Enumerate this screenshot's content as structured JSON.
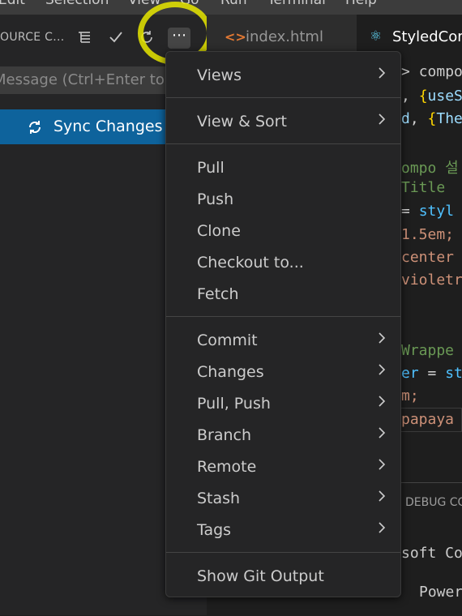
{
  "menubar": {
    "items": [
      "Edit",
      "Selection",
      "View",
      "Go",
      "Run",
      "Terminal",
      "Help"
    ]
  },
  "scm": {
    "title": "OURCE C...",
    "message_placeholder": "Message (Ctrl+Enter to co",
    "sync_label": "Sync Changes",
    "more_glyph": "⋯"
  },
  "tabs": [
    {
      "label": "index.html",
      "icon": "html-file-icon"
    },
    {
      "label": "StyledCom",
      "icon": "react-file-icon"
    }
  ],
  "editor": {
    "lines": [
      {
        "segments": [
          {
            "text": "> ",
            "color": "#cccccc"
          },
          {
            "text": "compo",
            "color": "#cccccc"
          }
        ]
      },
      {
        "segments": [
          {
            "text": ", ",
            "color": "#d4d4d4"
          },
          {
            "text": "{",
            "color": "#ffd700"
          },
          {
            "text": "useS",
            "color": "#9cdcfe"
          }
        ]
      },
      {
        "segments": [
          {
            "text": "d",
            "color": "#9cdcfe"
          },
          {
            "text": ", ",
            "color": "#d4d4d4"
          },
          {
            "text": "{",
            "color": "#ffd700"
          },
          {
            "text": "The",
            "color": "#9cdcfe"
          }
        ]
      },
      {
        "segments": [
          {
            "text": "ompo 설",
            "color": "#6a9955"
          }
        ]
      },
      {
        "segments": [
          {
            "text": " Title",
            "color": "#6a9955"
          }
        ]
      },
      {
        "segments": [
          {
            "text": " = ",
            "color": "#d4d4d4"
          },
          {
            "text": "styl",
            "color": "#4fc1ff"
          }
        ]
      },
      {
        "segments": [
          {
            "text": "1.5em;",
            "color": "#ce9178"
          }
        ]
      },
      {
        "segments": [
          {
            "text": " center",
            "color": "#ce9178"
          }
        ]
      },
      {
        "segments": [
          {
            "text": "violetr",
            "color": "#ce9178"
          }
        ]
      },
      {
        "segments": [
          {
            "text": " Wrappe",
            "color": "#6a9955"
          }
        ]
      },
      {
        "segments": [
          {
            "text": "er",
            "color": "#4fc1ff"
          },
          {
            "text": " = ",
            "color": "#d4d4d4"
          },
          {
            "text": "st",
            "color": "#4fc1ff"
          }
        ]
      },
      {
        "segments": [
          {
            "text": "m;",
            "color": "#ce9178"
          }
        ]
      },
      {
        "segments": [
          {
            "text": " papaya",
            "color": "#ce9178"
          }
        ]
      }
    ]
  },
  "panel": {
    "tab_label": "DEBUG CO",
    "line1": "soft Co",
    "line2": "Power"
  },
  "context_menu": {
    "groups": [
      [
        {
          "label": "Views",
          "submenu": true
        }
      ],
      [
        {
          "label": "View & Sort",
          "submenu": true
        }
      ],
      [
        {
          "label": "Pull",
          "submenu": false
        },
        {
          "label": "Push",
          "submenu": false
        },
        {
          "label": "Clone",
          "submenu": false
        },
        {
          "label": "Checkout to...",
          "submenu": false
        },
        {
          "label": "Fetch",
          "submenu": false
        }
      ],
      [
        {
          "label": "Commit",
          "submenu": true
        },
        {
          "label": "Changes",
          "submenu": true
        },
        {
          "label": "Pull, Push",
          "submenu": true
        },
        {
          "label": "Branch",
          "submenu": true
        },
        {
          "label": "Remote",
          "submenu": true
        },
        {
          "label": "Stash",
          "submenu": true
        },
        {
          "label": "Tags",
          "submenu": true
        }
      ],
      [
        {
          "label": "Show Git Output",
          "submenu": false
        }
      ]
    ]
  },
  "colors": {
    "accent": "#0e639c",
    "highlight": "#e8e800"
  }
}
